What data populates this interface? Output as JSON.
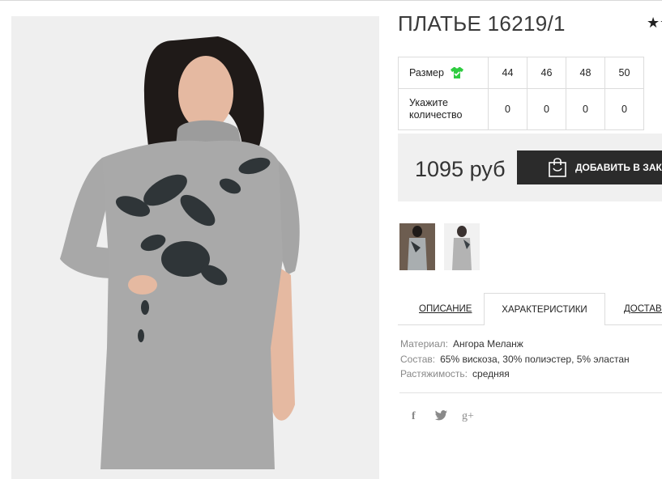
{
  "product": {
    "title": "ПЛАТЬЕ 16219/1",
    "favorite_icon": "star-icon"
  },
  "size_table": {
    "size_label": "Размер",
    "size_icon": "green-shirt-icon",
    "qty_label": "Укажите количество",
    "sizes": [
      "44",
      "46",
      "48",
      "50"
    ],
    "quantities": [
      "0",
      "0",
      "0",
      "0"
    ]
  },
  "purchase": {
    "price": "1095 руб",
    "add_button": "ДОБАВИТЬ В ЗАКАЗ",
    "cart_icon": "shopping-bag-icon"
  },
  "tabs": [
    {
      "label": "ОПИСАНИЕ",
      "active": false
    },
    {
      "label": "ХАРАКТЕРИСТИКИ",
      "active": true
    },
    {
      "label": "ДОСТАВКА",
      "active": false
    }
  ],
  "specs": [
    {
      "key": "Материал:",
      "value": "Ангора Меланж"
    },
    {
      "key": "Состав:",
      "value": "65% вискоза, 30% полиэстер, 5% эластан"
    },
    {
      "key": "Растяжимость:",
      "value": "средняя"
    }
  ],
  "social": [
    {
      "icon": "facebook-icon",
      "glyph": "f"
    },
    {
      "icon": "twitter-icon",
      "glyph": "🐦"
    },
    {
      "icon": "google-plus-icon",
      "glyph": "g+"
    }
  ],
  "colors": {
    "button": "#2b2b2b",
    "price_bg": "#f0f0f0",
    "size_icon": "#2ecc40"
  }
}
